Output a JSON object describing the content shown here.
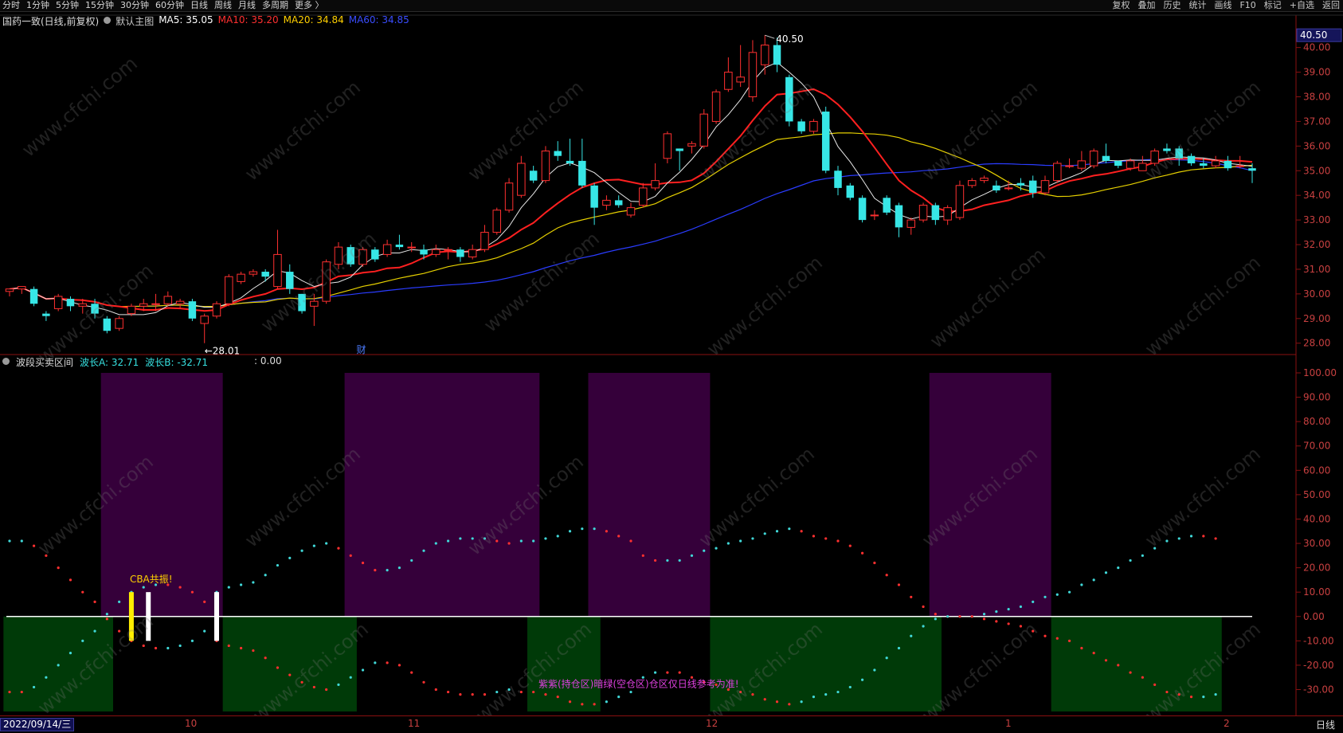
{
  "toolbar": {
    "tabs": [
      "分时",
      "1分钟",
      "5分钟",
      "15分钟",
      "30分钟",
      "60分钟",
      "日线",
      "周线",
      "月线",
      "多周期",
      "更多 〉"
    ],
    "active_tab": "日线",
    "right_actions": [
      "复权",
      "叠加",
      "历史",
      "统计",
      "画线",
      "F10",
      "+自选",
      "返回"
    ],
    "mark_label": "标记"
  },
  "main_panel": {
    "stock_label": "国药一致(日线,前复权)",
    "template_label": "默认主图",
    "ma5": "MA5: 35.05",
    "ma10": "MA10: 35.20",
    "ma20": "MA20: 34.84",
    "ma60": "MA60: 34.85",
    "high_marker": "40.50",
    "low_marker": "28.01",
    "finance_flag": "财",
    "current_price_tag": "40.50",
    "price_ticks": [
      "40.00",
      "39.00",
      "38.00",
      "37.00",
      "36.00",
      "35.00",
      "34.00",
      "33.00",
      "32.00",
      "31.00",
      "30.00",
      "29.00",
      "28.00"
    ]
  },
  "indicator_panel": {
    "title": "波段买卖区间",
    "wave_a": "波长A: 32.71",
    "wave_b": "波长B: -32.71",
    "extra": ": 0.00",
    "resonance_label": "CBA共振!",
    "zone_note": "紫紫(持仓区)暗绿(空仓区)仓区仅日线参考为准!",
    "value_ticks": [
      "100.00",
      "90.00",
      "80.00",
      "70.00",
      "60.00",
      "50.00",
      "40.00",
      "30.00",
      "20.00",
      "10.00",
      "0.00",
      "-10.00",
      "-20.00",
      "-30.00"
    ]
  },
  "date_axis": {
    "current_date": "2022/09/14/三",
    "month_ticks": [
      "10",
      "11",
      "12",
      "1",
      "2"
    ],
    "period": "日线"
  },
  "watermark": "www.cfchi.com",
  "chart_data": {
    "type": "candlestick",
    "candles": [
      [
        30.1,
        30.2,
        29.9,
        30.1
      ],
      [
        30.2,
        30.3,
        30.0,
        30.2
      ],
      [
        30.2,
        29.6,
        29.5,
        30.3
      ],
      [
        29.2,
        29.1,
        28.9,
        29.3
      ],
      [
        29.4,
        29.9,
        29.3,
        30.0
      ],
      [
        29.8,
        29.5,
        29.3,
        29.9
      ],
      [
        29.5,
        29.6,
        29.2,
        29.8
      ],
      [
        29.6,
        29.2,
        29.0,
        29.8
      ],
      [
        29.0,
        28.5,
        28.4,
        29.1
      ],
      [
        28.6,
        29.0,
        28.5,
        29.1
      ],
      [
        29.2,
        29.5,
        29.1,
        29.6
      ],
      [
        29.5,
        29.6,
        29.3,
        29.8
      ],
      [
        29.6,
        29.6,
        29.3,
        30.0
      ],
      [
        29.6,
        29.9,
        29.5,
        30.1
      ],
      [
        29.6,
        29.7,
        29.4,
        29.8
      ],
      [
        29.7,
        29.0,
        28.9,
        29.8
      ],
      [
        28.8,
        29.1,
        28.0,
        29.2
      ],
      [
        29.1,
        29.6,
        29.0,
        29.7
      ],
      [
        29.6,
        30.7,
        29.5,
        30.8
      ],
      [
        30.5,
        30.8,
        30.4,
        30.9
      ],
      [
        30.8,
        30.9,
        30.7,
        31.0
      ],
      [
        30.9,
        30.7,
        30.5,
        31.0
      ],
      [
        30.3,
        31.6,
        30.2,
        32.6
      ],
      [
        30.9,
        30.2,
        30.0,
        31.2
      ],
      [
        30.0,
        29.3,
        29.2,
        30.0
      ],
      [
        29.5,
        29.7,
        28.7,
        30.0
      ],
      [
        29.7,
        31.3,
        29.6,
        31.4
      ],
      [
        31.2,
        31.9,
        31.0,
        32.1
      ],
      [
        31.9,
        31.2,
        31.1,
        32.0
      ],
      [
        31.2,
        31.8,
        31.1,
        31.9
      ],
      [
        31.8,
        31.4,
        31.3,
        31.9
      ],
      [
        31.6,
        32.0,
        31.5,
        32.2
      ],
      [
        32.0,
        31.9,
        31.8,
        32.4
      ],
      [
        31.9,
        31.9,
        31.7,
        32.1
      ],
      [
        31.8,
        31.6,
        31.4,
        32.0
      ],
      [
        31.6,
        31.8,
        31.5,
        32.0
      ],
      [
        31.8,
        31.8,
        31.4,
        31.9
      ],
      [
        31.8,
        31.5,
        31.3,
        31.9
      ],
      [
        31.5,
        31.8,
        31.4,
        32.0
      ],
      [
        31.8,
        32.5,
        31.7,
        32.8
      ],
      [
        32.5,
        33.4,
        32.4,
        33.5
      ],
      [
        33.4,
        34.5,
        33.3,
        34.7
      ],
      [
        34.0,
        35.3,
        33.9,
        35.6
      ],
      [
        35.0,
        34.6,
        34.5,
        35.2
      ],
      [
        34.6,
        35.8,
        34.5,
        36.0
      ],
      [
        35.8,
        35.6,
        35.4,
        36.2
      ],
      [
        35.4,
        35.3,
        35.2,
        36.3
      ],
      [
        35.4,
        34.4,
        34.3,
        36.3
      ],
      [
        34.4,
        33.5,
        32.8,
        34.5
      ],
      [
        33.6,
        33.8,
        33.4,
        34.0
      ],
      [
        33.8,
        33.6,
        33.5,
        34.0
      ],
      [
        33.2,
        33.5,
        33.1,
        33.7
      ],
      [
        33.6,
        34.3,
        33.5,
        34.5
      ],
      [
        34.3,
        34.6,
        34.2,
        35.3
      ],
      [
        35.5,
        36.5,
        35.3,
        36.6
      ],
      [
        35.9,
        35.8,
        35.0,
        35.9
      ],
      [
        36.0,
        36.1,
        35.7,
        36.2
      ],
      [
        36.0,
        37.3,
        35.9,
        37.5
      ],
      [
        37.0,
        38.2,
        36.9,
        38.3
      ],
      [
        38.3,
        39.0,
        38.2,
        39.6
      ],
      [
        38.6,
        38.8,
        38.4,
        40.1
      ],
      [
        38.0,
        39.8,
        37.8,
        40.3
      ],
      [
        39.3,
        40.1,
        38.9,
        40.5
      ],
      [
        40.1,
        39.3,
        39.0,
        40.4
      ],
      [
        38.8,
        37.0,
        36.8,
        38.9
      ],
      [
        37.0,
        36.6,
        36.5,
        37.1
      ],
      [
        36.6,
        37.0,
        36.5,
        37.1
      ],
      [
        37.4,
        35.0,
        34.9,
        37.6
      ],
      [
        35.0,
        34.3,
        34.0,
        35.2
      ],
      [
        34.4,
        33.9,
        33.8,
        34.5
      ],
      [
        33.9,
        33.0,
        32.9,
        34.0
      ],
      [
        33.2,
        33.2,
        33.0,
        33.4
      ],
      [
        33.9,
        33.3,
        33.2,
        34.0
      ],
      [
        33.6,
        32.7,
        32.3,
        33.7
      ],
      [
        32.7,
        33.0,
        32.4,
        33.1
      ],
      [
        33.0,
        33.6,
        32.9,
        33.7
      ],
      [
        33.6,
        33.0,
        32.8,
        33.7
      ],
      [
        33.0,
        33.5,
        32.8,
        33.6
      ],
      [
        33.1,
        34.4,
        33.0,
        34.6
      ],
      [
        34.4,
        34.6,
        34.3,
        34.7
      ],
      [
        34.6,
        34.7,
        34.5,
        34.8
      ],
      [
        34.4,
        34.2,
        34.1,
        34.6
      ],
      [
        34.3,
        34.3,
        34.2,
        34.6
      ],
      [
        34.5,
        34.4,
        34.2,
        34.7
      ],
      [
        34.6,
        34.1,
        33.9,
        34.8
      ],
      [
        34.1,
        34.6,
        34.0,
        34.8
      ],
      [
        34.6,
        35.3,
        34.5,
        35.4
      ],
      [
        35.2,
        35.2,
        35.1,
        35.5
      ],
      [
        35.1,
        35.4,
        35.0,
        35.8
      ],
      [
        35.2,
        35.8,
        35.1,
        35.9
      ],
      [
        35.6,
        35.4,
        35.3,
        36.1
      ],
      [
        35.4,
        35.2,
        35.1,
        35.4
      ],
      [
        35.1,
        35.4,
        35.0,
        35.5
      ],
      [
        35.0,
        35.3,
        35.0,
        35.6
      ],
      [
        35.3,
        35.8,
        35.2,
        35.9
      ],
      [
        35.9,
        35.8,
        35.7,
        36.1
      ],
      [
        35.9,
        35.5,
        35.2,
        36.0
      ],
      [
        35.6,
        35.3,
        35.2,
        35.7
      ],
      [
        35.3,
        35.2,
        35.1,
        35.5
      ],
      [
        35.2,
        35.4,
        35.1,
        35.6
      ],
      [
        35.4,
        35.1,
        35.0,
        35.6
      ],
      [
        35.2,
        35.2,
        35.1,
        35.6
      ],
      [
        35.1,
        35.0,
        34.5,
        35.3
      ]
    ],
    "ylim": [
      27.7,
      40.7
    ],
    "indicator": {
      "ylim": [
        -39,
        100
      ],
      "values": [
        31,
        31,
        29,
        25,
        20,
        15,
        10,
        6,
        -1,
        -6,
        -10,
        -12,
        -13,
        -13,
        -12,
        -10,
        -6,
        10,
        12,
        13,
        14,
        17,
        21,
        24,
        27,
        29,
        30,
        28,
        25,
        22,
        19,
        19,
        20,
        23,
        27,
        30,
        31,
        32,
        32,
        32,
        31,
        30,
        31,
        31,
        32,
        33,
        35,
        36,
        36,
        35,
        33,
        31,
        25,
        23,
        23,
        23,
        25,
        27,
        28,
        30,
        31,
        32,
        34,
        35,
        36,
        35,
        33,
        32,
        31,
        29,
        26,
        22,
        17,
        13,
        8,
        4,
        1,
        0,
        0,
        0,
        -1,
        -2,
        -3,
        -4,
        -6,
        -8,
        -9,
        -10,
        -13,
        -15,
        -18,
        -20,
        -23,
        -25,
        -28,
        -31,
        -32,
        -33,
        -33,
        -32
      ],
      "hold_zones": [
        [
          8,
          17
        ],
        [
          28,
          43
        ],
        [
          48,
          57
        ],
        [
          76,
          85
        ]
      ],
      "empty_zones": [
        [
          0,
          8
        ],
        [
          18,
          28
        ],
        [
          43,
          48
        ],
        [
          58,
          76
        ],
        [
          86,
          99
        ]
      ],
      "resonance_marks": [
        10,
        11,
        17
      ]
    }
  }
}
